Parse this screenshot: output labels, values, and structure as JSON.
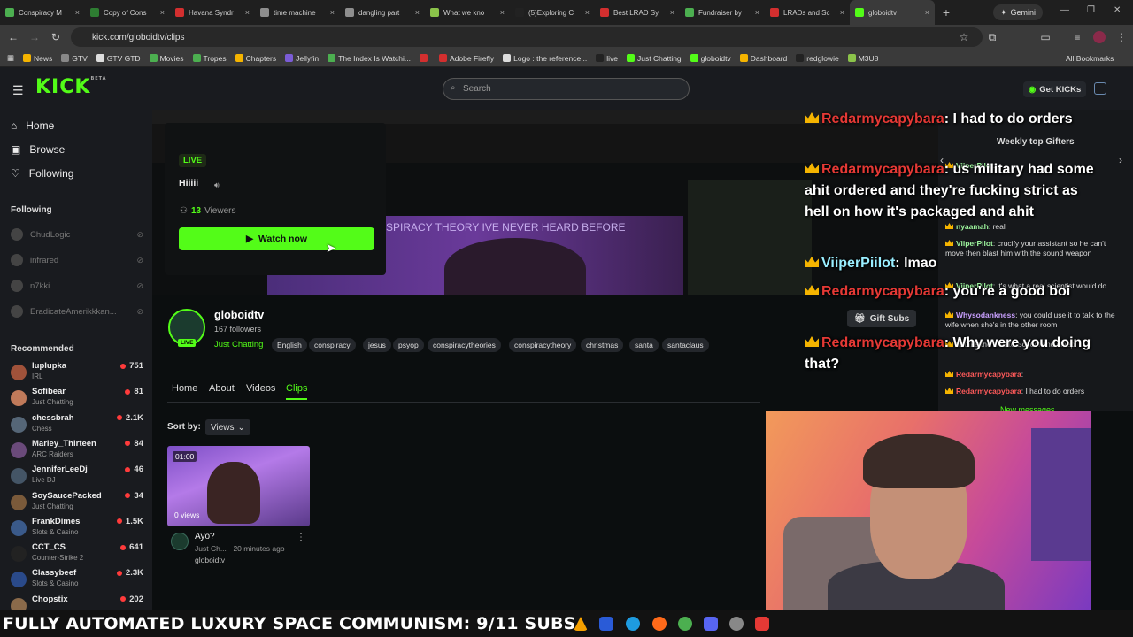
{
  "browser": {
    "tabs": [
      {
        "title": "Conspiracy M",
        "color": "#4caf50"
      },
      {
        "title": "Copy of Cons",
        "color": "#2e7d32"
      },
      {
        "title": "Havana Syndr",
        "color": "#d32f2f"
      },
      {
        "title": "time machine",
        "color": "#8e8e8e"
      },
      {
        "title": "dangling part",
        "color": "#8e8e8e"
      },
      {
        "title": "What we kno",
        "color": "#8bc34a"
      },
      {
        "title": "(5)Exploring C",
        "color": "#222222"
      },
      {
        "title": "Best LRAD Sy",
        "color": "#d32f2f"
      },
      {
        "title": "Fundraiser by",
        "color": "#4caf50"
      },
      {
        "title": "LRADs and Sc",
        "color": "#d32f2f"
      },
      {
        "title": "globoidtv",
        "color": "#53fc18"
      }
    ],
    "gemini_label": "Gemini",
    "url": "kick.com/globoidtv/clips",
    "bookmarks": [
      {
        "label": "News",
        "color": "#f5b400"
      },
      {
        "label": "GTV",
        "color": "#888888"
      },
      {
        "label": "GTV GTD",
        "color": "#dddddd"
      },
      {
        "label": "Movies",
        "color": "#4caf50"
      },
      {
        "label": "Tropes",
        "color": "#4caf50"
      },
      {
        "label": "Chapters",
        "color": "#f5b400"
      },
      {
        "label": "Jellyfin",
        "color": "#7b5cd6"
      },
      {
        "label": "The Index Is Watchi...",
        "color": "#4caf50"
      },
      {
        "label": "",
        "color": "#d32f2f"
      },
      {
        "label": "Adobe Firefly",
        "color": "#d32f2f"
      },
      {
        "label": "Logo : the reference...",
        "color": "#dddddd"
      },
      {
        "label": "live",
        "color": "#222222"
      },
      {
        "label": "Just Chatting",
        "color": "#53fc18"
      },
      {
        "label": "globoidtv",
        "color": "#53fc18"
      },
      {
        "label": "Dashboard",
        "color": "#f5b400"
      },
      {
        "label": "redglowie",
        "color": "#222222"
      },
      {
        "label": "M3U8",
        "color": "#8bc34a"
      }
    ],
    "all_bookmarks": "All Bookmarks"
  },
  "header": {
    "logo": "KICK",
    "logo_sup": "BETA",
    "search_placeholder": "Search",
    "get_kicks": "Get KICKs"
  },
  "sidebar": {
    "nav": [
      "Home",
      "Browse",
      "Following"
    ],
    "following_heading": "Following",
    "following": [
      "ChudLogic",
      "infrared",
      "n7kki",
      "EradicateAmerikkkan..."
    ],
    "recommended_heading": "Recommended",
    "recommended": [
      {
        "name": "luplupka",
        "category": "IRL",
        "viewers": "751",
        "color": "#a0523a"
      },
      {
        "name": "Sofibear",
        "category": "Just Chatting",
        "viewers": "81",
        "color": "#c07a5a"
      },
      {
        "name": "chessbrah",
        "category": "Chess",
        "viewers": "2.1K",
        "color": "#556677"
      },
      {
        "name": "Marley_Thirteen",
        "category": "ARC Raiders",
        "viewers": "84",
        "color": "#6a4a7a"
      },
      {
        "name": "JenniferLeeDj",
        "category": "Live DJ",
        "viewers": "46",
        "color": "#445566"
      },
      {
        "name": "SoySaucePacked",
        "category": "Just Chatting",
        "viewers": "34",
        "color": "#7a5a3a"
      },
      {
        "name": "FrankDimes",
        "category": "Slots & Casino",
        "viewers": "1.5K",
        "color": "#3a5a8a"
      },
      {
        "name": "CCT_CS",
        "category": "Counter-Strike 2",
        "viewers": "641",
        "color": "#222222"
      },
      {
        "name": "Classybeef",
        "category": "Slots & Casino",
        "viewers": "2.3K",
        "color": "#2a4a8a"
      },
      {
        "name": "Chopstix",
        "category": "",
        "viewers": "202",
        "color": "#8a6a4a"
      }
    ]
  },
  "hero": {
    "live_badge": "LIVE",
    "stream_title": "Hiiiii",
    "viewers_count": "13",
    "viewers_label": "Viewers",
    "watch_now": "Watch now",
    "banner_text": "SPIRACY THEORY IVE NEVER HEARD BEFORE"
  },
  "channel": {
    "name": "globoidtv",
    "followers": "167 followers",
    "category": "Just Chatting",
    "live_chip": "LIVE",
    "tags": [
      "English",
      "conspiracy",
      "jesus",
      "psyop",
      "conspiracytheories",
      "conspiracytheory",
      "christmas",
      "santa",
      "santaclaus"
    ],
    "tabs": [
      "Home",
      "About",
      "Videos",
      "Clips"
    ],
    "active_tab": "Clips",
    "sort_label": "Sort by:",
    "sort_value": "Views",
    "gift_subs": "Gift Subs"
  },
  "clip": {
    "duration": "01:00",
    "views": "0 views",
    "title": "Ayo?",
    "meta": "Just Ch... · 20 minutes ago",
    "channel": "globoidtv"
  },
  "chat_panel": {
    "heading": "Weekly top Gifters",
    "messages": [
      {
        "user": "ViiperPilot",
        "text": ""
      },
      {
        "user": "nyaamah",
        "text": "real"
      },
      {
        "user": "ViiperPilot",
        "text": "crucify your assistant so he can't move then blast him with the sound weapon"
      },
      {
        "user": "ViiperPilot",
        "text": "it's what a real scientist would do"
      },
      {
        "user": "Whysodankness",
        "text": "you could use it to talk to the wife when she's in the other room"
      },
      {
        "user": "",
        "text": "to take the kids to School and sleep"
      },
      {
        "user": "Redarmycapybara",
        "text": ""
      },
      {
        "user": "Redarmycapybara",
        "text": "I had to do orders"
      }
    ],
    "new_messages": "New messages"
  },
  "overlay_chat": [
    {
      "user": "Redarmycapybara",
      "text": "I had to do orders"
    },
    {
      "user": "Redarmycapybara",
      "text": "us military had some ahit ordered and they're fucking strict as hell on how it's packaged and ahit"
    },
    {
      "user": "ViiperPiilot",
      "text": "lmao"
    },
    {
      "user": "Redarmycapybara",
      "text": "you're a good boi"
    },
    {
      "user": "Redarmycapybara",
      "text": "Why were you doing that?"
    }
  ],
  "ticker": "FULLY AUTOMATED LUXURY SPACE COMMUNISM: 9/11 SUBS"
}
